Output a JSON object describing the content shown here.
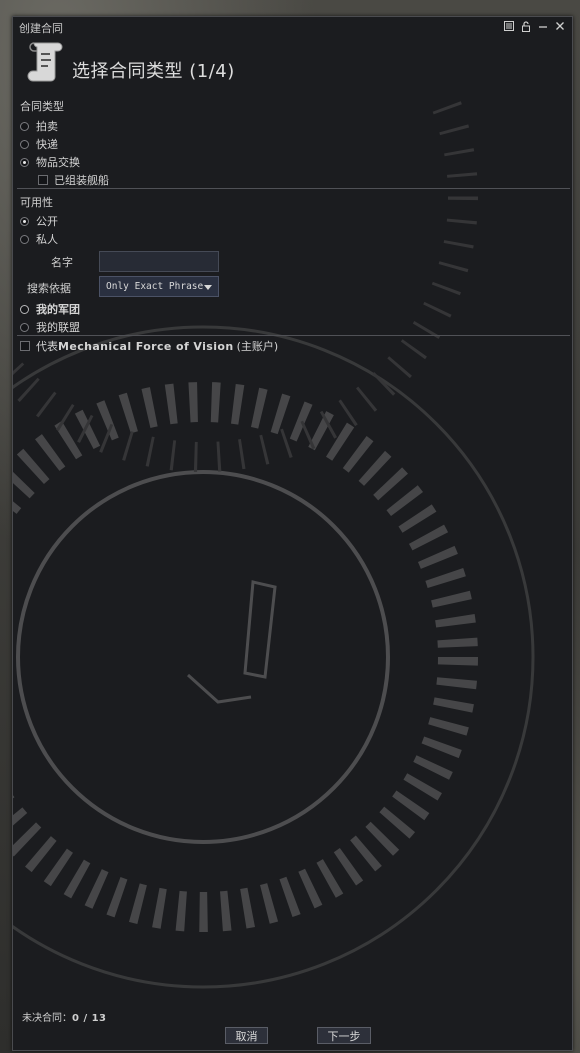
{
  "window": {
    "title": "创建合同",
    "controls": [
      {
        "name": "window-settings-icon"
      },
      {
        "name": "lock-icon"
      },
      {
        "name": "minimize-icon"
      },
      {
        "name": "close-icon"
      }
    ]
  },
  "header": {
    "icon": "contract-scroll-icon",
    "title": "选择合同类型 (1/4)"
  },
  "contract_type": {
    "label": "合同类型",
    "options": [
      {
        "label": "拍卖",
        "selected": false
      },
      {
        "label": "快递",
        "selected": false
      },
      {
        "label": "物品交换",
        "selected": true
      }
    ],
    "assembled_ship": {
      "label": "已组装舰船",
      "checked": false
    }
  },
  "availability": {
    "label": "可用性",
    "options": [
      {
        "label": "公开",
        "selected": true
      },
      {
        "label": "私人",
        "selected": false
      }
    ],
    "name_field": {
      "label": "名字",
      "value": "",
      "placeholder": ""
    },
    "search_by": {
      "label": "搜索依据",
      "selected": "Only Exact Phrase"
    },
    "corp": {
      "label": "我的军团",
      "selected": false
    },
    "alliance": {
      "label": "我的联盟",
      "selected": false
    }
  },
  "on_behalf": {
    "label_prefix": "代表",
    "label_name": "Mechanical Force of Vision",
    "label_suffix": "(主账户)",
    "checked": false
  },
  "footer": {
    "outstanding_label": "未决合同：",
    "outstanding_value": "0 / 13",
    "cancel_label": "取消",
    "next_label": "下一步"
  }
}
